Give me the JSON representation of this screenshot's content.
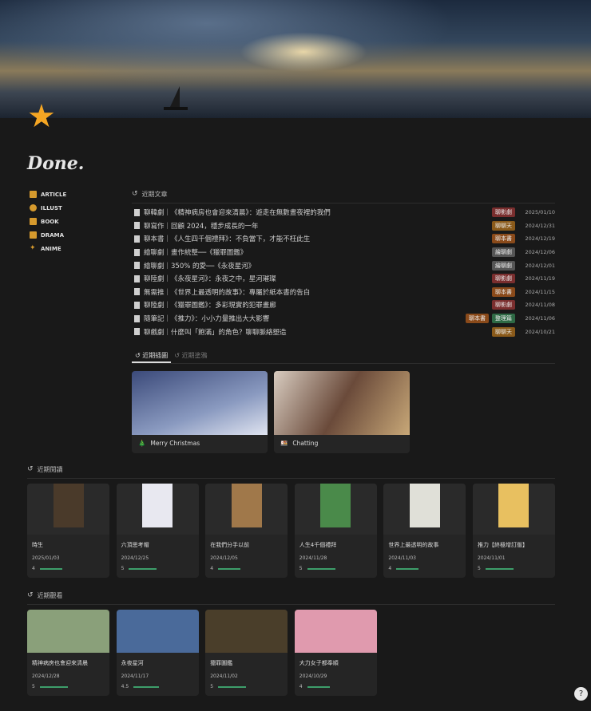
{
  "page": {
    "title": "Done."
  },
  "sidebar": {
    "items": [
      {
        "label": "ARTICLE"
      },
      {
        "label": "ILLUST"
      },
      {
        "label": "BOOK"
      },
      {
        "label": "DRAMA"
      },
      {
        "label": "ANIME"
      }
    ]
  },
  "articles": {
    "header": "近期文章",
    "rows": [
      {
        "title": "聊韓劇｜《精神病房也會迎來清晨》：遊走在無數晝夜裡的我們",
        "tags": [
          {
            "label": "聊影劇",
            "color": "#7a2e2e"
          }
        ],
        "date": "2025/01/10"
      },
      {
        "title": "聊寫作｜回顧 2024，穩步成長的一年",
        "tags": [
          {
            "label": "聊聊天",
            "color": "#8a5a1a"
          }
        ],
        "date": "2024/12/31"
      },
      {
        "title": "聊本書｜《人生四千個禮拜》：不負當下，才能不枉此生",
        "tags": [
          {
            "label": "聊本書",
            "color": "#8a4a1a"
          }
        ],
        "date": "2024/12/19"
      },
      {
        "title": "繪聊劇｜畫作統整──《獵罪圖鑑》",
        "tags": [
          {
            "label": "繪聊劇",
            "color": "#555"
          }
        ],
        "date": "2024/12/06"
      },
      {
        "title": "繪聊劇｜350% 的愛──《永夜星河》",
        "tags": [
          {
            "label": "繪聊劇",
            "color": "#555"
          }
        ],
        "date": "2024/12/01"
      },
      {
        "title": "聊陸劇｜《永夜星河》：永夜之中，星河璀璨",
        "tags": [
          {
            "label": "聊影劇",
            "color": "#7a2e2e"
          }
        ],
        "date": "2024/11/19"
      },
      {
        "title": "無需推｜《世界上最透明的故事》：專屬於紙本書的告白",
        "tags": [
          {
            "label": "聊本書",
            "color": "#8a4a1a"
          }
        ],
        "date": "2024/11/15"
      },
      {
        "title": "聊陸劇｜《獵罪圖鑑》：多彩現實的犯罪畫廊",
        "tags": [
          {
            "label": "聊影劇",
            "color": "#7a2e2e"
          }
        ],
        "date": "2024/11/08"
      },
      {
        "title": "隨筆記｜《推力》：小小力量推出大大影響",
        "tags": [
          {
            "label": "聊本書",
            "color": "#8a4a1a"
          },
          {
            "label": "整理篇",
            "color": "#2e6a45"
          }
        ],
        "date": "2024/11/06"
      },
      {
        "title": "聊戲劇｜什麼叫「飽滿」的角色？聊聊脈絡塑造",
        "tags": [
          {
            "label": "聊聊天",
            "color": "#8a5a1a"
          }
        ],
        "date": "2024/10/21"
      }
    ]
  },
  "gallery": {
    "tabs": [
      {
        "label": "近期插圖"
      },
      {
        "label": "近期塗鴉"
      }
    ],
    "items": [
      {
        "icon": "🎄",
        "title": "Merry Christmas"
      },
      {
        "icon": "🍱",
        "title": "Chatting"
      }
    ]
  },
  "reading": {
    "header": "近期閱讀",
    "items": [
      {
        "title": "時生",
        "date": "2025/01/03",
        "rating": 4,
        "cover": "#4a3a2a"
      },
      {
        "title": "六頂思考帽",
        "date": "2024/12/25",
        "rating": 5,
        "cover": "#e8e8f0"
      },
      {
        "title": "在我們分手以前",
        "date": "2024/12/05",
        "rating": 4,
        "cover": "#a0784a"
      },
      {
        "title": "人生4千個禮拜",
        "date": "2024/11/28",
        "rating": 5,
        "cover": "#4a8a4a"
      },
      {
        "title": "世界上最透明的故事",
        "date": "2024/11/03",
        "rating": 4,
        "cover": "#e0e0d8"
      },
      {
        "title": "推力【終極增訂版】",
        "date": "2024/11/01",
        "rating": 5,
        "cover": "#e8c060"
      }
    ]
  },
  "watching": {
    "header": "近期觀看",
    "items": [
      {
        "title": "精神病房也會迎來清晨",
        "date": "2024/12/28",
        "rating": "5",
        "cover": "#8aa07a"
      },
      {
        "title": "永夜星河",
        "date": "2024/11/17",
        "rating": "4.5",
        "cover": "#4a6a9a"
      },
      {
        "title": "獵罪圖鑑",
        "date": "2024/11/02",
        "rating": "5",
        "cover": "#4a3e2a"
      },
      {
        "title": "大力女子都奉順",
        "date": "2024/10/29",
        "rating": "4",
        "cover": "#e09aae"
      }
    ]
  },
  "help": {
    "label": "?"
  }
}
